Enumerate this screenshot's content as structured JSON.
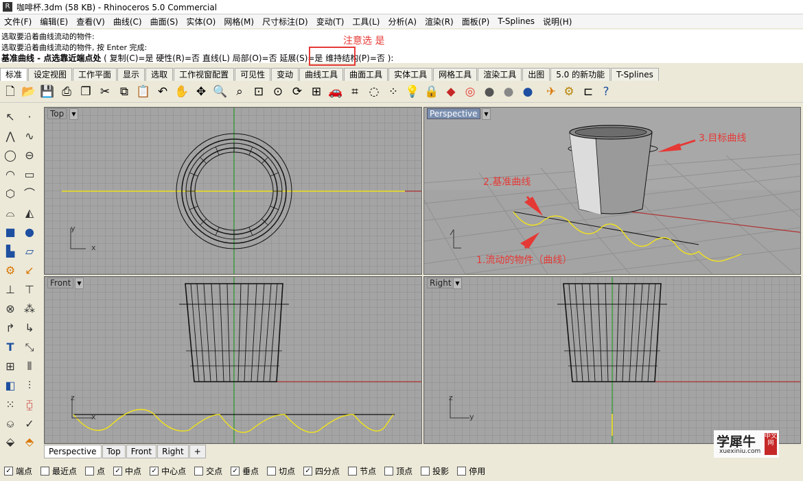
{
  "window": {
    "title": "咖啡杯.3dm (58 KB) - Rhinoceros 5.0 Commercial"
  },
  "menu": [
    "文件(F)",
    "编辑(E)",
    "查看(V)",
    "曲线(C)",
    "曲面(S)",
    "实体(O)",
    "网格(M)",
    "尺寸标注(D)",
    "变动(T)",
    "工具(L)",
    "分析(A)",
    "渲染(R)",
    "面板(P)",
    "T-Splines",
    "说明(H)"
  ],
  "command": {
    "history": [
      "选取要沿着曲线流动的物件:",
      "选取要沿着曲线流动的物件, 按 Enter 完成:"
    ],
    "prompt_bold": "基准曲线 - 点选靠近端点处",
    "prompt_rest": "( 复制(C)=是  硬性(R)=否  直线(L)  局部(O)=否  延展(S)=是  维持结构(P)=否 ):",
    "annotation": "注意选 是"
  },
  "tabs": [
    "标准",
    "设定视图",
    "工作平面",
    "显示",
    "选取",
    "工作视窗配置",
    "可见性",
    "变动",
    "曲线工具",
    "曲面工具",
    "实体工具",
    "网格工具",
    "渲染工具",
    "出图",
    "5.0 的新功能",
    "T-Splines"
  ],
  "toolbar_icons": [
    "new-icon",
    "open-icon",
    "save-icon",
    "print-icon",
    "import-icon",
    "cut-icon",
    "copy-icon",
    "paste-icon",
    "undo-icon",
    "pan-icon",
    "rotate-view-icon",
    "zoom-icon",
    "zoom-window-icon",
    "zoom-extents-icon",
    "zoom-selected-icon",
    "rotate-icon",
    "four-view-icon",
    "car-icon",
    "grid-icon",
    "circle-icon",
    "points-icon",
    "light-icon",
    "lock-icon",
    "layer-icon",
    "color-wheel-icon",
    "sphere-icon",
    "sphere-gray-icon",
    "sphere-blue-icon",
    "light-select-icon",
    "gear-icon",
    "dimension-icon",
    "help-icon"
  ],
  "viewports": {
    "top": {
      "label": "Top"
    },
    "perspective": {
      "label": "Perspective"
    },
    "front": {
      "label": "Front"
    },
    "right": {
      "label": "Right"
    }
  },
  "axis": {
    "x": "x",
    "y": "y",
    "z": "z"
  },
  "callouts": {
    "target": "3.目标曲线",
    "base": "2.基准曲线",
    "flow": "1.流动的物件（曲线）"
  },
  "viewport_tabs": [
    "Perspective",
    "Top",
    "Front",
    "Right",
    "+"
  ],
  "osnap": [
    {
      "label": "端点",
      "checked": true
    },
    {
      "label": "最近点",
      "checked": false
    },
    {
      "label": "点",
      "checked": false
    },
    {
      "label": "中点",
      "checked": true
    },
    {
      "label": "中心点",
      "checked": true
    },
    {
      "label": "交点",
      "checked": false
    },
    {
      "label": "垂点",
      "checked": true
    },
    {
      "label": "切点",
      "checked": false
    },
    {
      "label": "四分点",
      "checked": true
    },
    {
      "label": "节点",
      "checked": false
    },
    {
      "label": "顶点",
      "checked": false
    },
    {
      "label": "投影",
      "checked": false
    },
    {
      "label": "停用",
      "checked": false
    }
  ],
  "watermark": {
    "title": "学犀牛",
    "site": "xuexiniu.com",
    "badge": "中文网"
  },
  "colors": {
    "viewport_bg": "#a4a4a4",
    "grid": "#8c8c8c",
    "annotation": "#e53935",
    "curve": "#f2e31a",
    "axis_x": "#b03030",
    "axis_y": "#2e9e2e"
  }
}
